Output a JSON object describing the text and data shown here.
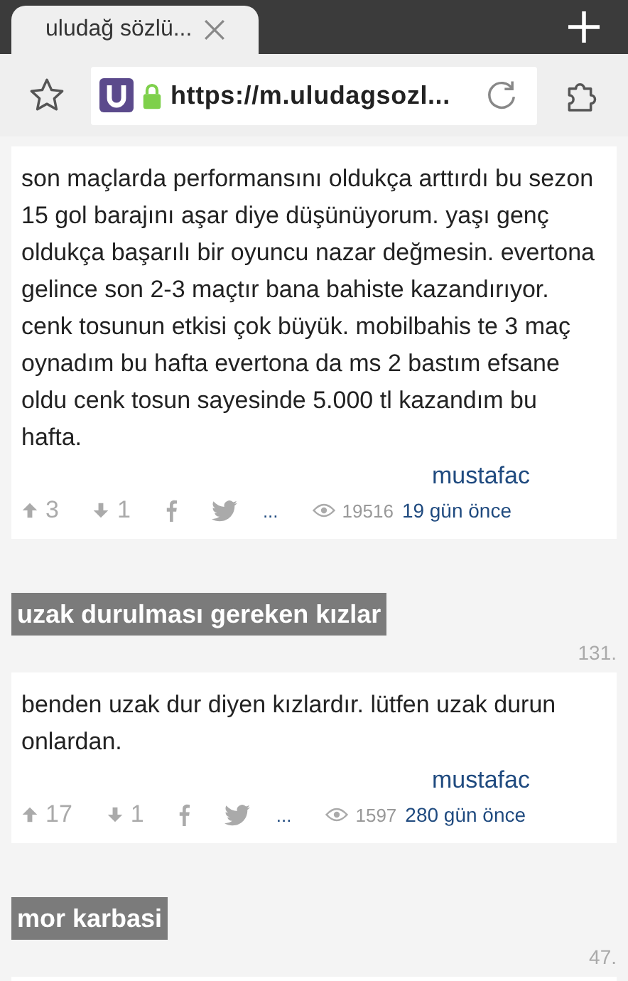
{
  "browser": {
    "tab_title": "uludağ sözlü...",
    "url": "https://m.uludagsozl..."
  },
  "entries": [
    {
      "kind": "entry",
      "text_lines": [
        "son maçlarda performansını oldukça arttırdı bu sezon",
        "15 gol barajını aşar diye düşünüyorum. yaşı genç",
        "oldukça başarılı bir oyuncu nazar değmesin. evertona",
        "gelince son 2-3 maçtır bana bahiste kazandırıyor.",
        "cenk tosunun etkisi çok büyük. mobilbahis te 3 maç",
        "oynadım bu hafta evertona da ms 2 bastım efsane",
        "oldu cenk tosun sayesinde 5.000 tl kazandım bu",
        "hafta."
      ],
      "author": "mustafac",
      "upvotes": "3",
      "downvotes": "1",
      "more": "...",
      "views": "19516",
      "date": "19 gün önce"
    },
    {
      "kind": "entry",
      "title": "uzak durulması gereken kızlar",
      "number": "131.",
      "text_lines": [
        "benden uzak dur diyen kızlardır. lütfen uzak durun",
        "onlardan."
      ],
      "author": "mustafac",
      "upvotes": "17",
      "downvotes": "1",
      "more": "...",
      "views": "1597",
      "date": "280 gün önce"
    },
    {
      "kind": "stub",
      "title": "mor karbasi",
      "number": "47."
    }
  ]
}
